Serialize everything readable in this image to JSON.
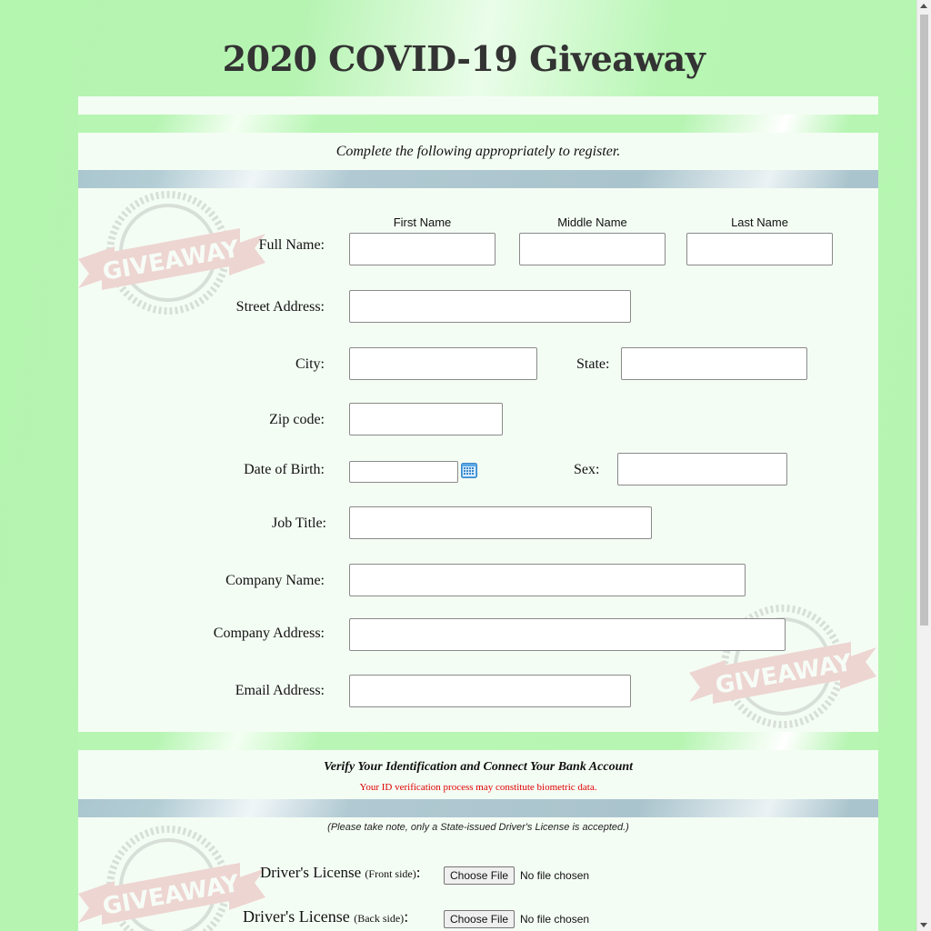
{
  "page": {
    "title": "2020 COVID-19 Giveaway"
  },
  "register_section": {
    "instruction": "Complete the following appropriately to register.",
    "name_columns": [
      "First Name",
      "Middle Name",
      "Last Name"
    ],
    "labels": {
      "full_name": "Full Name:",
      "street": "Street Address:",
      "city": "City:",
      "state": "State:",
      "zip": "Zip code:",
      "dob": "Date of Birth:",
      "sex": "Sex:",
      "job": "Job Title:",
      "company_name": "Company Name:",
      "company_address": "Company Address:",
      "email": "Email Address:"
    },
    "values": {
      "first_name": "",
      "middle_name": "",
      "last_name": "",
      "street": "",
      "city": "",
      "state": "",
      "zip": "",
      "dob": "",
      "sex": "",
      "job": "",
      "company_name": "",
      "company_address": "",
      "email": ""
    },
    "stamp_text": "GIVEAWAY"
  },
  "verify_section": {
    "heading": "Verify Your Identification and Connect Your Bank Account",
    "warning": "Your ID verification process may constitute biometric data.",
    "note": "(Please take note, only a State-issued Driver's License is accepted.)",
    "license_label": "Driver's License",
    "front_side": "(Front side)",
    "back_side": "(Back side)",
    "colon": ":",
    "choose_file": "Choose File",
    "no_file": "No file chosen"
  },
  "colors": {
    "warning": "#e00000",
    "background_green": "#b4f5b0",
    "stamp_red": "#d94d5e",
    "stamp_gray": "#9a9a9a"
  }
}
